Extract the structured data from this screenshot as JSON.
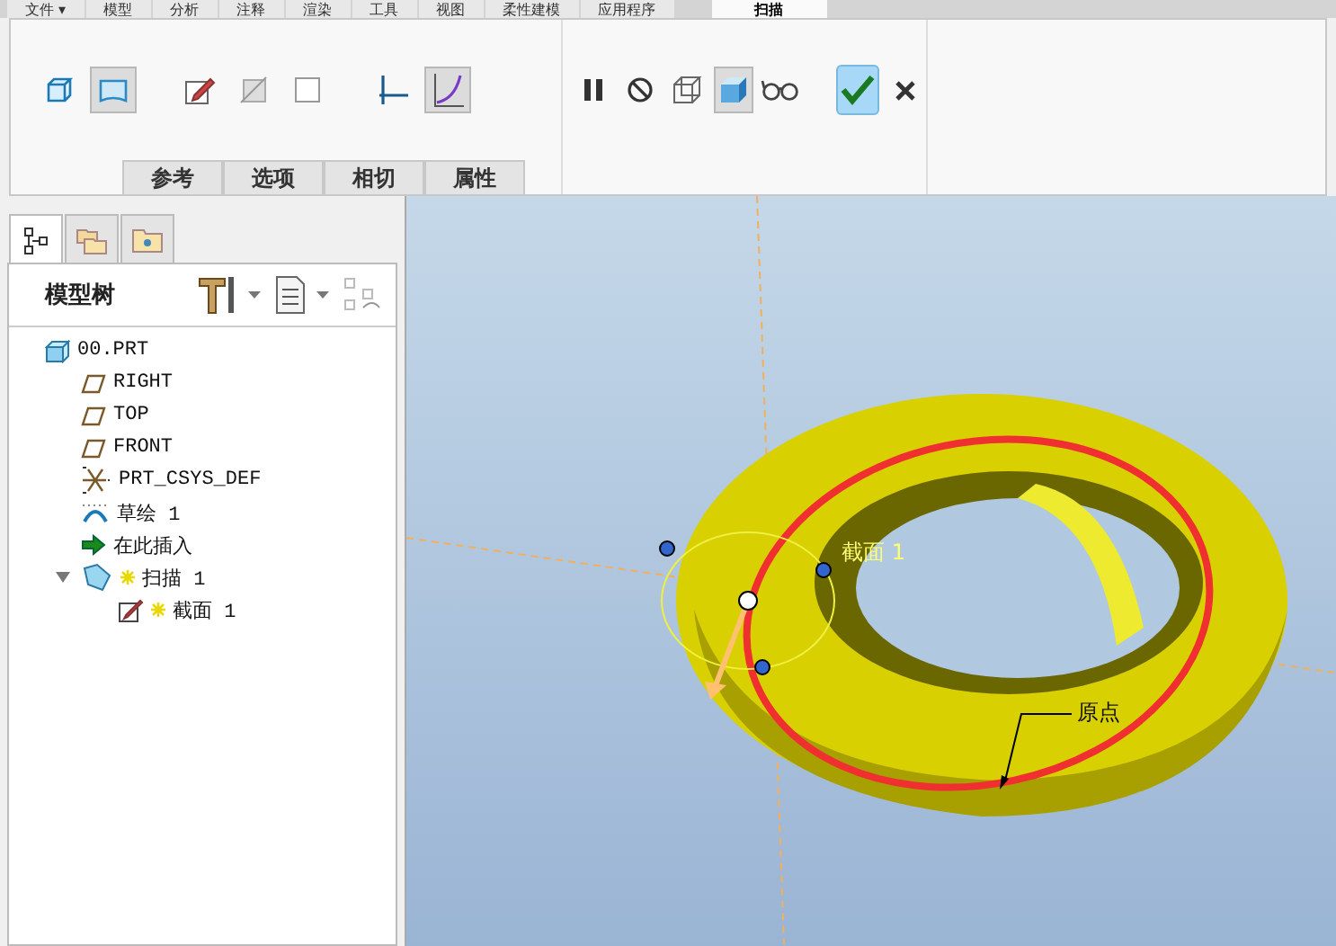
{
  "menu_tabs": [
    {
      "label": "文件 ▾",
      "selected": false
    },
    {
      "label": "模型",
      "selected": false
    },
    {
      "label": "分析",
      "selected": false
    },
    {
      "label": "注释",
      "selected": false
    },
    {
      "label": "渲染",
      "selected": false
    },
    {
      "label": "工具",
      "selected": false
    },
    {
      "label": "视图",
      "selected": false
    },
    {
      "label": "柔性建模",
      "selected": false
    },
    {
      "label": "应用程序",
      "selected": false
    },
    {
      "label": "扫描",
      "selected": true
    }
  ],
  "ribbon": {
    "tool_buttons": [
      {
        "kind": "solid",
        "pressed": false
      },
      {
        "kind": "surface",
        "pressed": true
      },
      {
        "kind": "sketch",
        "pressed": false
      },
      {
        "kind": "remove",
        "pressed": false
      },
      {
        "kind": "thicken",
        "pressed": false
      },
      {
        "kind": "constant",
        "pressed": false
      },
      {
        "kind": "variable",
        "pressed": true
      }
    ],
    "control_buttons": [
      {
        "kind": "pause",
        "pressed": false
      },
      {
        "kind": "no-preview",
        "pressed": false
      },
      {
        "kind": "wireframe",
        "pressed": false
      },
      {
        "kind": "shaded",
        "pressed": true
      },
      {
        "kind": "glasses",
        "pressed": false
      },
      {
        "kind": "ok",
        "pressed": false
      },
      {
        "kind": "cancel",
        "pressed": false
      }
    ],
    "subtabs": [
      "参考",
      "选项",
      "相切",
      "属性"
    ]
  },
  "panel": {
    "tabs": [
      {
        "kind": "tree",
        "selected": true
      },
      {
        "kind": "folders",
        "selected": false
      },
      {
        "kind": "favorites",
        "selected": false
      }
    ],
    "title": "模型树",
    "tree": [
      {
        "label": "00.PRT",
        "kind": "part",
        "new": false,
        "children": [
          {
            "label": "RIGHT",
            "kind": "plane",
            "new": false
          },
          {
            "label": "TOP",
            "kind": "plane",
            "new": false
          },
          {
            "label": "FRONT",
            "kind": "plane",
            "new": false
          },
          {
            "label": "PRT_CSYS_DEF",
            "kind": "csys",
            "new": false
          },
          {
            "label": "草绘 1",
            "kind": "sketch",
            "new": false
          },
          {
            "label": "在此插入",
            "kind": "insert",
            "new": false
          },
          {
            "label": "扫描 1",
            "kind": "sweep",
            "new": true,
            "expanded": true,
            "children": [
              {
                "label": "截面 1",
                "kind": "section",
                "new": true
              }
            ]
          }
        ]
      }
    ]
  },
  "viewport": {
    "section_label": "截面 1",
    "origin_label": "原点"
  }
}
